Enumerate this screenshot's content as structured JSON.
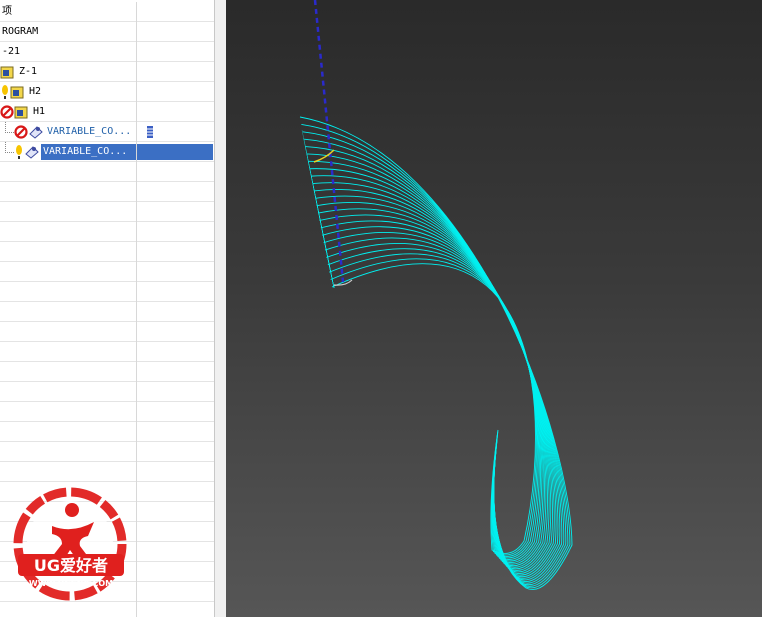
{
  "navigator": {
    "rows": [
      {
        "label": "项"
      },
      {
        "label": "ROGRAM"
      },
      {
        "label": "-21"
      },
      {
        "label": "Z-1"
      },
      {
        "label": "H2"
      },
      {
        "label": "H1"
      },
      {
        "label": "VARIABLE_CO..."
      },
      {
        "label": "VARIABLE_CO..."
      }
    ]
  },
  "watermark": {
    "brand": "UG爱好者",
    "url": "WWW.UGSNX.COM"
  },
  "colors": {
    "toolpath": "#00f0f0",
    "tool_axis": "#2a2acc",
    "selection": "#3b6fc4",
    "watermark_red": "#e0201e"
  }
}
